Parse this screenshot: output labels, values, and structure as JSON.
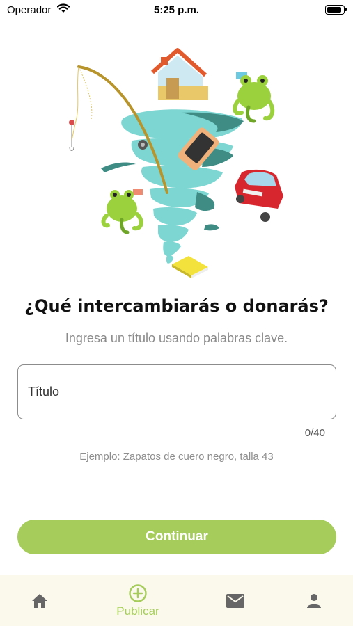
{
  "status_bar": {
    "carrier": "Operador",
    "time": "5:25 p.m."
  },
  "illustration": {
    "icon": "trade-tornado-illustration"
  },
  "header": {
    "title": "¿Qué intercambiarás o donarás?",
    "subtitle": "Ingresa un título usando palabras clave."
  },
  "form": {
    "title_placeholder": "Título",
    "title_value": "",
    "counter": "0/40",
    "example": "Ejemplo: Zapatos de cuero negro, talla 43"
  },
  "actions": {
    "continue_label": "Continuar"
  },
  "bottom_nav": {
    "items": [
      {
        "icon": "home-icon",
        "label": ""
      },
      {
        "icon": "add-circle-icon",
        "label": "Publicar",
        "active": true
      },
      {
        "icon": "mail-icon",
        "label": ""
      },
      {
        "icon": "person-icon",
        "label": ""
      }
    ]
  },
  "colors": {
    "accent": "#a6cc5b",
    "nav_background": "#fbf9ec",
    "nav_icon": "#666666"
  }
}
